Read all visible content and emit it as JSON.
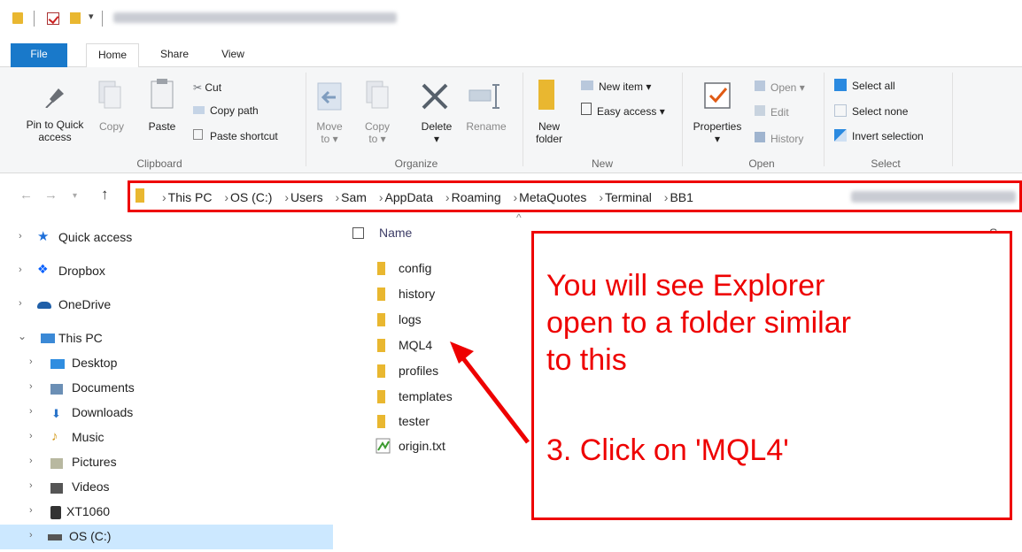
{
  "window": {
    "title_blurred": ""
  },
  "ribbon_tabs": [
    {
      "label": "File"
    },
    {
      "label": "Home"
    },
    {
      "label": "Share"
    },
    {
      "label": "View"
    }
  ],
  "clipboard": {
    "pin_label_1": "Pin to Quick",
    "pin_label_2": "access",
    "copy": "Copy",
    "paste": "Paste",
    "cut": "Cut",
    "copy_path": "Copy path",
    "paste_shortcut": "Paste shortcut",
    "group": "Clipboard"
  },
  "organize": {
    "move_to_1": "Move",
    "move_to_2": "to ▾",
    "copy_to_1": "Copy",
    "copy_to_2": "to ▾",
    "delete_1": "Delete",
    "delete_2": "▾",
    "rename": "Rename",
    "group": "Organize"
  },
  "new": {
    "new_folder_1": "New",
    "new_folder_2": "folder",
    "new_item": "New item ▾",
    "easy_access": "Easy access ▾",
    "group": "New"
  },
  "open": {
    "properties_1": "Properties",
    "properties_2": "▾",
    "open": "Open ▾",
    "edit": "Edit",
    "history": "History",
    "group": "Open"
  },
  "select": {
    "select_all": "Select all",
    "select_none": "Select none",
    "invert": "Invert selection",
    "group": "Select"
  },
  "address": {
    "crumbs": [
      "This PC",
      "OS (C:)",
      "Users",
      "Sam",
      "AppData",
      "Roaming",
      "MetaQuotes",
      "Terminal",
      "BB1"
    ]
  },
  "nav_pane": [
    {
      "label": "Quick access",
      "icon": "star-icon",
      "color": "#1e6fd9"
    },
    {
      "label": "Dropbox",
      "icon": "dropbox-icon",
      "color": "#0a61fe"
    },
    {
      "label": "OneDrive",
      "icon": "cloud-icon",
      "color": "#1f5fa8"
    },
    {
      "label": "This PC",
      "icon": "computer-icon",
      "color": "#3b89d6"
    },
    {
      "label": "Desktop",
      "icon": "desktop-icon",
      "color": "#2f8de0"
    },
    {
      "label": "Documents",
      "icon": "documents-icon",
      "color": "#6b8fb5"
    },
    {
      "label": "Downloads",
      "icon": "downloads-icon",
      "color": "#2a74c9"
    },
    {
      "label": "Music",
      "icon": "music-icon",
      "color": "#d49a1a"
    },
    {
      "label": "Pictures",
      "icon": "pictures-icon",
      "color": "#b8b8a0"
    },
    {
      "label": "Videos",
      "icon": "videos-icon",
      "color": "#555555"
    },
    {
      "label": "XT1060",
      "icon": "phone-icon",
      "color": "#333333"
    },
    {
      "label": "OS (C:)",
      "icon": "drive-icon",
      "color": "#555555"
    }
  ],
  "file_list": {
    "header_name": "Name",
    "header_s": "S",
    "items": [
      {
        "label": "config",
        "type": "folder"
      },
      {
        "label": "history",
        "type": "folder"
      },
      {
        "label": "logs",
        "type": "folder"
      },
      {
        "label": "MQL4",
        "type": "folder"
      },
      {
        "label": "profiles",
        "type": "folder"
      },
      {
        "label": "templates",
        "type": "folder"
      },
      {
        "label": "tester",
        "type": "folder"
      },
      {
        "label": "origin.txt",
        "type": "text-file"
      }
    ]
  },
  "annotation": {
    "line1": "You will see Explorer",
    "line2": "open to a folder similar",
    "line3": "to this",
    "line4": "3. Click on 'MQL4'",
    "color": "#e00000"
  }
}
